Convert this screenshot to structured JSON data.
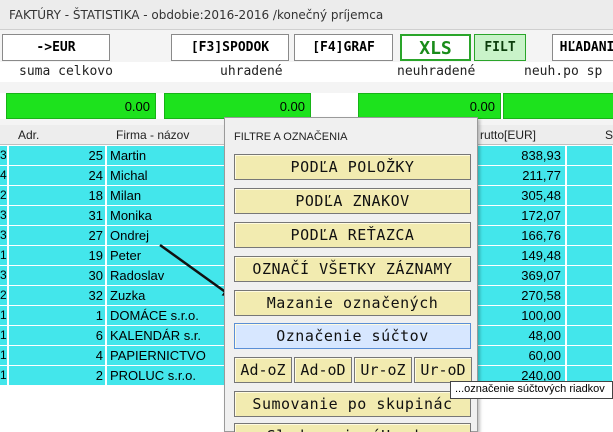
{
  "window": {
    "title": "FAKTÚRY - ŠTATISTIKA - obdobie:2016-2016 /konečný príjemca"
  },
  "toolbar": {
    "eur": "->EUR",
    "f3": "[F3]SPODOK",
    "f4": "[F4]GRAF",
    "xls": "XLS",
    "filt": "FILT",
    "hladani": "HĽADANI"
  },
  "summary": {
    "labels": [
      "suma celkovo",
      "uhradené",
      "neuhradené",
      "neuh.po sp"
    ],
    "values": [
      "0.00",
      "0.00",
      "0.00"
    ]
  },
  "grid": {
    "headers": {
      "adr": "Adr.",
      "firma": "Firma - názov",
      "brutto": "rutto[EUR]",
      "s": "S"
    },
    "rows": [
      {
        "mark": "3",
        "adr": "25",
        "firma": "Martin",
        "brutto": "838,93"
      },
      {
        "mark": "4",
        "adr": "24",
        "firma": "Michal",
        "brutto": "211,77"
      },
      {
        "mark": "2",
        "adr": "18",
        "firma": "Milan",
        "brutto": "305,48"
      },
      {
        "mark": "3",
        "adr": "31",
        "firma": "Monika",
        "brutto": "172,07"
      },
      {
        "mark": "3",
        "adr": "27",
        "firma": "Ondrej",
        "brutto": "166,76"
      },
      {
        "mark": "1",
        "adr": "19",
        "firma": "Peter",
        "brutto": "149,48"
      },
      {
        "mark": "3",
        "adr": "30",
        "firma": "Radoslav",
        "brutto": "369,07"
      },
      {
        "mark": "2",
        "adr": "32",
        "firma": "Zuzka",
        "brutto": "270,58"
      },
      {
        "mark": "1",
        "adr": "1",
        "firma": "DOMÁCE s.r.o.",
        "brutto": "100,00"
      },
      {
        "mark": "1",
        "adr": "6",
        "firma": "KALENDÁR s.r.",
        "brutto": "48,00"
      },
      {
        "mark": "1",
        "adr": "4",
        "firma": "PAPIERNICTVO",
        "brutto": "60,00"
      },
      {
        "mark": "1",
        "adr": "2",
        "firma": "PROLUC s.r.o.",
        "brutto": "240,00"
      }
    ]
  },
  "popup": {
    "title": "FILTRE A OZNAČENIA",
    "buttons": [
      "PODĽA POLOŽKY",
      "PODĽA ZNAKOV",
      "PODĽA REŤAZCA",
      "OZNAČÍ VŠETKY ZÁZNAMY",
      "Mazanie označených",
      "Označenie súčtov"
    ],
    "small_buttons": [
      "Ad-oZ",
      "Ad-oD",
      "Ur-oZ",
      "Ur-oD"
    ],
    "buttons2": [
      "Sumovanie po skupinác",
      "Sledovanie úHrad  >"
    ]
  },
  "tooltip": "...označenie súčtových riadkov"
}
